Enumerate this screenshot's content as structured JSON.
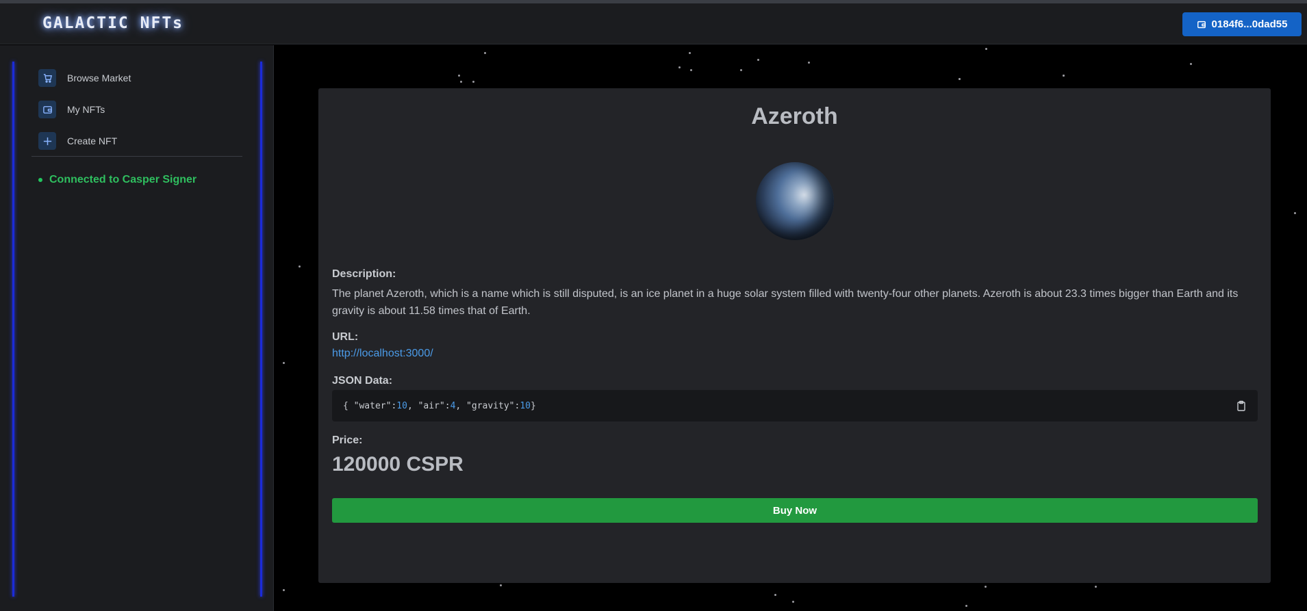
{
  "header": {
    "logo": "GALACTIC NFTs",
    "wallet_label": "0184f6...0dad55",
    "wallet_icon": "wallet-icon"
  },
  "sidebar": {
    "items": [
      {
        "label": "Browse Market",
        "icon": "cart-icon"
      },
      {
        "label": "My NFTs",
        "icon": "wallet-icon"
      },
      {
        "label": "Create NFT",
        "icon": "plus-icon"
      }
    ],
    "status": "Connected to Casper Signer"
  },
  "nft": {
    "title": "Azeroth",
    "description_label": "Description:",
    "description": "The planet Azeroth, which is a name which is still disputed, is an ice planet in a huge solar system filled with twenty-four other planets. Azeroth is about 23.3 times bigger than Earth and its gravity is about 11.58 times that of Earth.",
    "url_label": "URL:",
    "url": "http://localhost:3000/",
    "json_label": "JSON Data:",
    "json": {
      "open": "{",
      "water_key": "\"water\": ",
      "water_val": "10",
      "air_key": ", \"air\": ",
      "air_val": "4",
      "gravity_key": ", \"gravity\": ",
      "gravity_val": "10",
      "close": " }"
    },
    "price_label": "Price:",
    "price": "120000 CSPR",
    "buy_label": "Buy Now"
  },
  "colors": {
    "accent": "#1463c6",
    "success": "#22993f",
    "status_green": "#2fbf5f",
    "sidebar_line": "#1b2bd9",
    "link": "#4b9be8"
  }
}
